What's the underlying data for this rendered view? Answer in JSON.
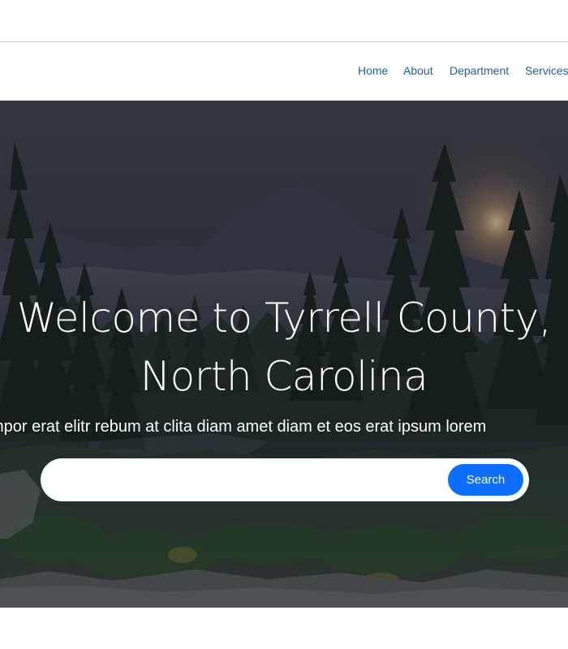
{
  "nav": {
    "items": [
      {
        "label": "Home"
      },
      {
        "label": "About"
      },
      {
        "label": "Department"
      },
      {
        "label": "Services"
      }
    ]
  },
  "hero": {
    "title_line1": "Welcome to Tyrrell County,",
    "title_line2": "North Carolina",
    "subtitle": "mpor erat elitr rebum at clita diam amet diam et eos erat ipsum lorem",
    "background": "forest-mountain-sunset-photo"
  },
  "search": {
    "value": "",
    "placeholder": "",
    "button_label": "Search"
  },
  "colors": {
    "nav_link": "#1f5ea8",
    "button": "#0d6efd",
    "divider": "#c9c9c9"
  }
}
